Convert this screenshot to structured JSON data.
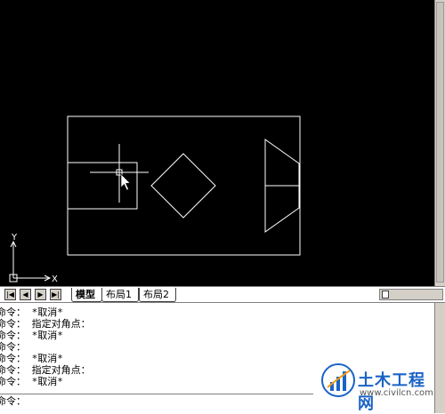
{
  "canvas": {
    "background": "#000000",
    "line_color": "#ffffff",
    "ucs": {
      "x_label": "X",
      "y_label": "Y"
    }
  },
  "tabs": {
    "nav_buttons": [
      "first-tab-icon",
      "prev-tab-icon",
      "next-tab-icon",
      "last-tab-icon"
    ],
    "items": [
      {
        "label": "模型",
        "active": true
      },
      {
        "label": "布局1",
        "active": false
      },
      {
        "label": "布局2",
        "active": false
      }
    ]
  },
  "command": {
    "history": [
      "命令： *取消*",
      "命令： 指定对角点：",
      "命令： *取消*",
      "命令：",
      "命令： *取消*",
      "命令： 指定对角点：",
      "命令： *取消*"
    ],
    "prompt": "命令："
  },
  "watermark": {
    "title": "土木工程网",
    "url": "www.civilcn.com",
    "accent": "#1a63c6"
  }
}
